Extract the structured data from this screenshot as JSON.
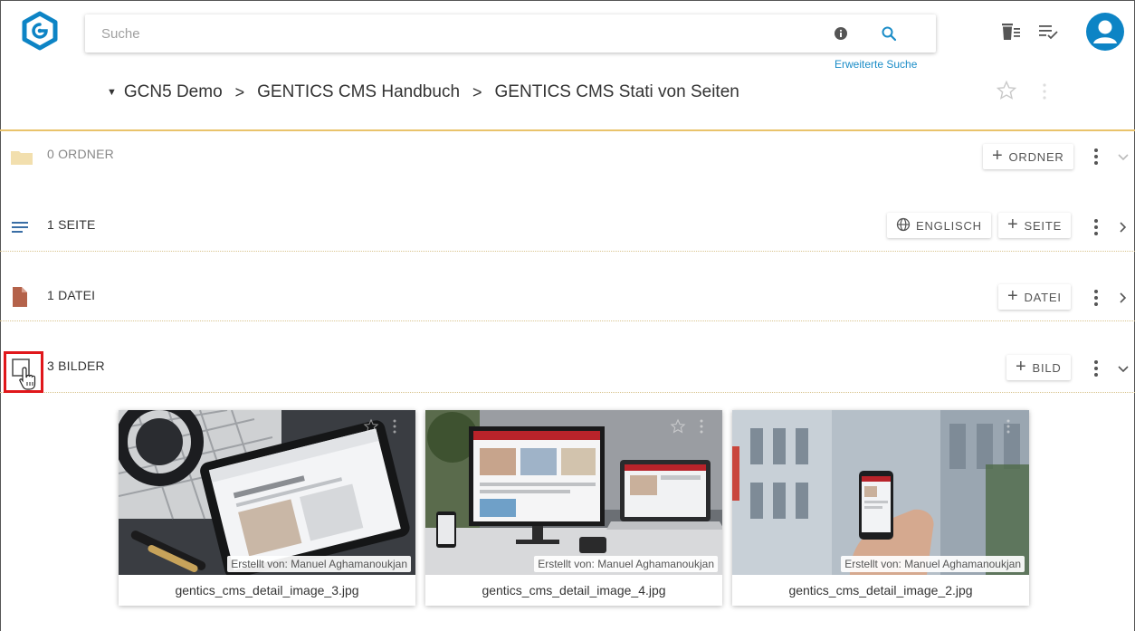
{
  "search": {
    "placeholder": "Suche",
    "advanced_link": "Erweiterte Suche"
  },
  "icons": {
    "logo": "gentics-logo-icon",
    "info": "info-icon",
    "search": "search-icon",
    "wastebin": "wastebin-icon",
    "message_list": "list-check-icon",
    "user": "user-avatar-icon"
  },
  "breadcrumb": {
    "items": [
      "GCN5 Demo",
      "GENTICS CMS Handbuch",
      "GENTICS CMS Stati von Seiten"
    ],
    "separator": ">"
  },
  "sections": {
    "folders": {
      "title": "0 ORDNER",
      "add_label": "ORDNER"
    },
    "pages": {
      "title": "1 SEITE",
      "language_label": "ENGLISCH",
      "add_label": "SEITE"
    },
    "files": {
      "title": "1 DATEI",
      "add_label": "DATEI"
    },
    "images": {
      "title": "3 BILDER",
      "add_label": "BILD"
    }
  },
  "images": [
    {
      "name": "gentics_cms_detail_image_3.jpg",
      "created": "Erstellt von: Manuel Aghamanoukjan"
    },
    {
      "name": "gentics_cms_detail_image_4.jpg",
      "created": "Erstellt von: Manuel Aghamanoukjan"
    },
    {
      "name": "gentics_cms_detail_image_2.jpg",
      "created": "Erstellt von: Manuel Aghamanoukjan"
    }
  ],
  "colors": {
    "brand": "#0d84c5",
    "header_rule": "#e9c36b",
    "folder": "#f2dfae",
    "file": "#b4624a",
    "highlight": "#e0171b"
  }
}
